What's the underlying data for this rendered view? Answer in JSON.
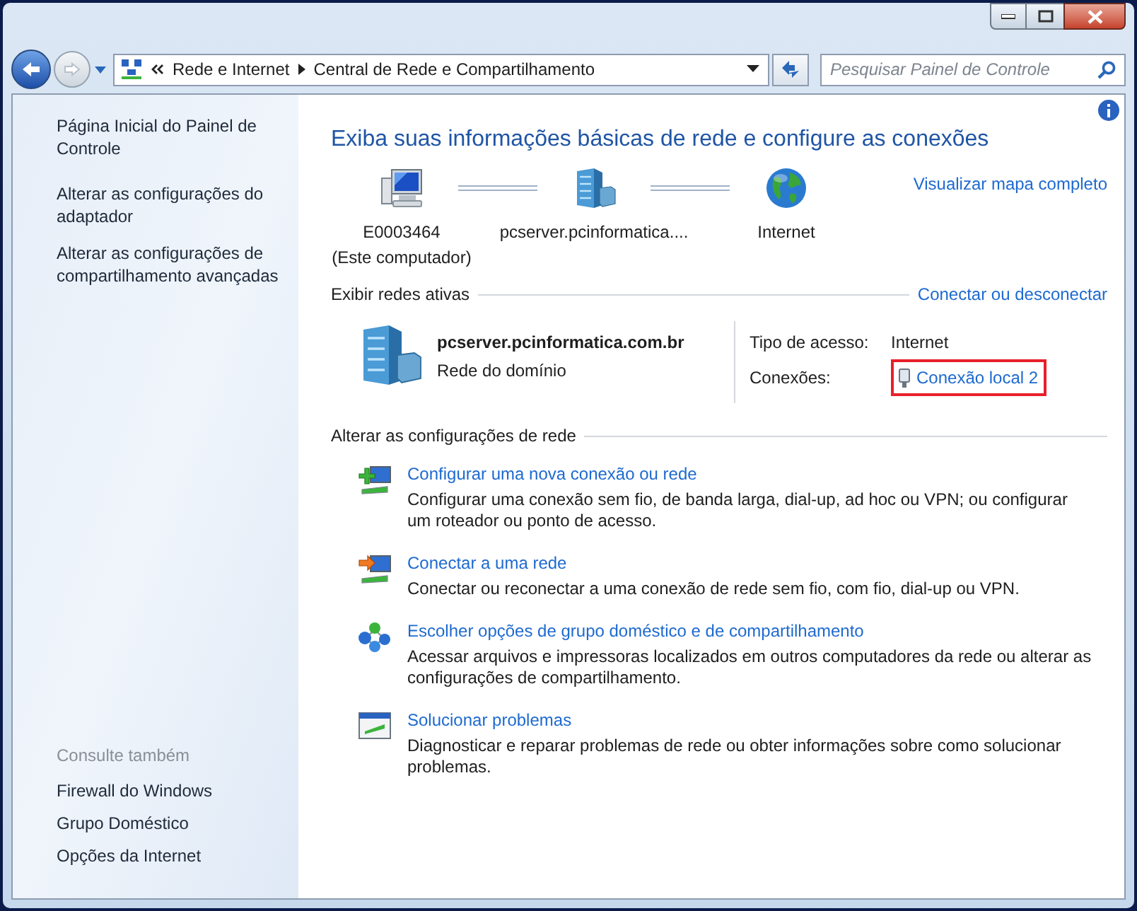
{
  "address_bar": {
    "breadcrumbs": [
      "Rede e Internet",
      "Central de Rede e Compartilhamento"
    ],
    "search": {
      "placeholder": "Pesquisar Painel de Controle"
    }
  },
  "sidebar": {
    "links": [
      "Página Inicial do Painel de Controle",
      "Alterar as configurações do adaptador",
      "Alterar as configurações de compartilhamento avançadas"
    ],
    "see_also": {
      "title": "Consulte também",
      "links": [
        "Firewall do Windows",
        "Grupo Doméstico",
        "Opções da Internet"
      ]
    }
  },
  "main": {
    "title": "Exiba suas informações básicas de rede e configure as conexões",
    "map": {
      "link": "Visualizar mapa completo",
      "nodes": [
        {
          "kind": "computer",
          "label": "E0003464",
          "sublabel": "(Este computador)"
        },
        {
          "kind": "server",
          "label": "pcserver.pcinformatica...."
        },
        {
          "kind": "globe",
          "label": "Internet"
        }
      ]
    },
    "active_networks": {
      "title": "Exibir redes ativas",
      "link": "Conectar ou desconectar",
      "network": {
        "name": "pcserver.pcinformatica.com.br",
        "type": "Rede do domínio"
      },
      "properties": [
        {
          "kind": "text",
          "label": "Tipo de acesso:",
          "value": "Internet",
          "highlighted": false
        },
        {
          "kind": "link",
          "label": "Conexões:",
          "value": "Conexão local 2",
          "highlighted": true
        }
      ]
    },
    "change_settings": {
      "title": "Alterar as configurações de rede",
      "tasks": [
        {
          "kind": "new-connection",
          "title": "Configurar uma nova conexão ou rede",
          "description": "Configurar uma conexão sem fio, de banda larga, dial-up, ad hoc ou VPN; ou configurar um roteador ou ponto de acesso."
        },
        {
          "kind": "connect",
          "title": "Conectar a uma rede",
          "description": "Conectar ou reconectar a uma conexão de rede sem fio, com fio, dial-up ou VPN."
        },
        {
          "kind": "homegroup",
          "title": "Escolher opções de grupo doméstico e de compartilhamento",
          "description": "Acessar arquivos e impressoras localizados em outros computadores da rede ou alterar as configurações de compartilhamento."
        },
        {
          "kind": "troubleshoot",
          "title": "Solucionar problemas",
          "description": "Diagnosticar e reparar problemas de rede ou obter informações sobre como solucionar problemas."
        }
      ]
    }
  }
}
